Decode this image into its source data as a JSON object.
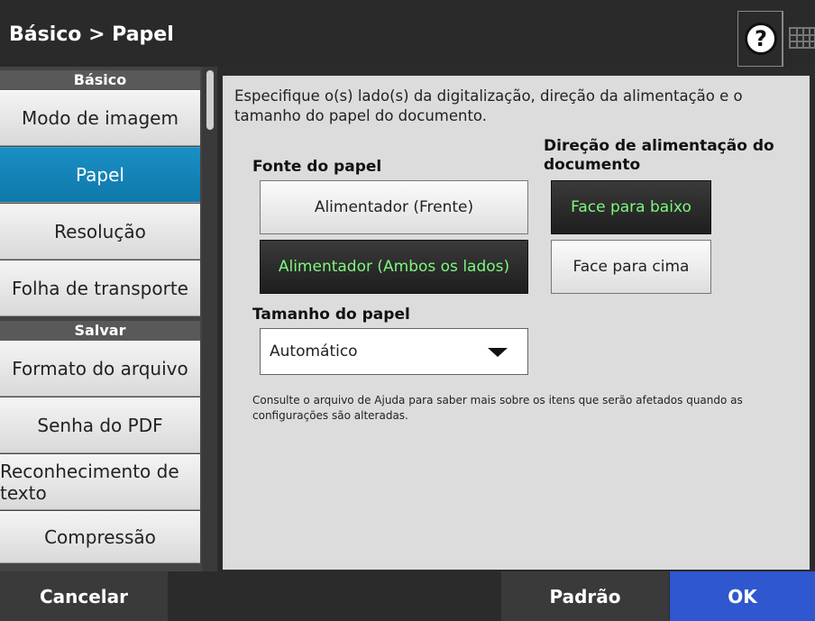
{
  "header": {
    "title": "Básico > Papel",
    "help_label": "?",
    "help_icon": "question-icon",
    "keyboard_icon": "keyboard-icon"
  },
  "sidebar": {
    "section_basic": "Básico",
    "section_save": "Salvar",
    "items": [
      {
        "label": "Modo de imagem"
      },
      {
        "label": "Papel",
        "active": true
      },
      {
        "label": "Resolução"
      },
      {
        "label": "Folha de transporte"
      },
      {
        "label": "Formato do arquivo"
      },
      {
        "label": "Senha do PDF"
      },
      {
        "label": "Reconhecimento de texto"
      },
      {
        "label": "Compressão"
      }
    ]
  },
  "main": {
    "description": "Especifique o(s) lado(s) da digitalização, direção da alimentação e o tamanho do papel do documento.",
    "paper_source": {
      "label": "Fonte do papel",
      "options": [
        "Alimentador (Frente)",
        "Alimentador (Ambos os lados)"
      ],
      "selected": "Alimentador (Ambos os lados)"
    },
    "feed_direction": {
      "label": "Direção de alimentação do documento",
      "options": [
        "Face para baixo",
        "Face para cima"
      ],
      "selected": "Face para baixo"
    },
    "paper_size": {
      "label": "Tamanho do papel",
      "value": "Automático"
    },
    "note": "Consulte o arquivo de Ajuda para saber mais sobre os itens que serão afetados quando as configurações são alteradas."
  },
  "footer": {
    "cancel": "Cancelar",
    "default": "Padrão",
    "ok": "OK"
  },
  "colors": {
    "accent_active": "#1a8fc4",
    "ok_button": "#2f57cf",
    "selected_text": "#7df77d"
  }
}
